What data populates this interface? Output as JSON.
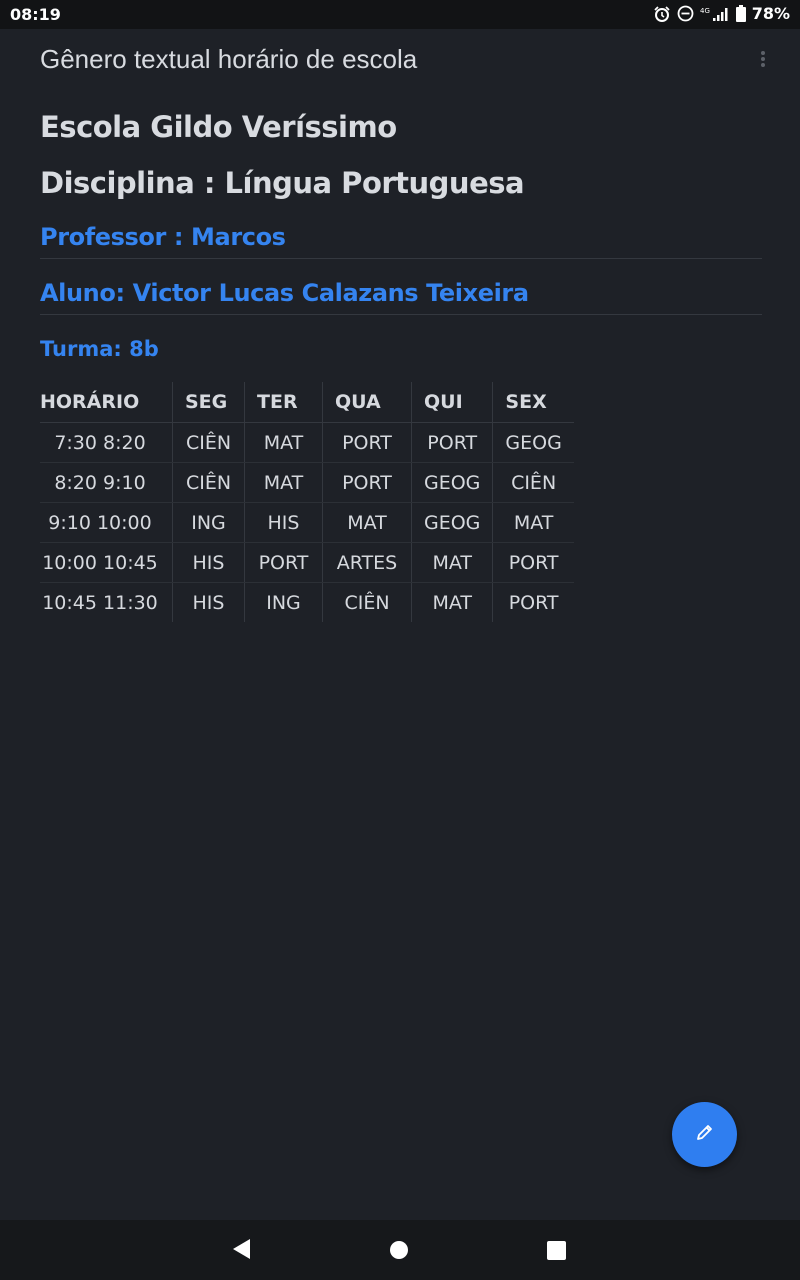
{
  "status_bar": {
    "time": "08:19",
    "network": "4G",
    "battery": "78%"
  },
  "toolbar": {
    "title": "Gênero textual horário de escola"
  },
  "document": {
    "school": "Escola Gildo Veríssimo",
    "discipline": "Disciplina : Língua Portuguesa",
    "teacher": "Professor : Marcos",
    "student": "Aluno: Victor Lucas Calazans Teixeira",
    "class": "Turma: 8b"
  },
  "schedule": {
    "headers": [
      "HORÁRIO",
      "SEG",
      "TER",
      "QUA",
      "QUI",
      "SEX"
    ],
    "rows": [
      [
        "7:30 8:20",
        "CIÊN",
        "MAT",
        "PORT",
        "PORT",
        "GEOG"
      ],
      [
        "8:20 9:10",
        "CIÊN",
        "MAT",
        "PORT",
        "GEOG",
        "CIÊN"
      ],
      [
        "9:10 10:00",
        "ING",
        "HIS",
        "MAT",
        "GEOG",
        "MAT"
      ],
      [
        "10:00 10:45",
        "HIS",
        "PORT",
        "ARTES",
        "MAT",
        "PORT"
      ],
      [
        "10:45 11:30",
        "HIS",
        "ING",
        "CIÊN",
        "MAT",
        "PORT"
      ]
    ]
  },
  "colors": {
    "background": "#1e2127",
    "accent": "#3584f0",
    "text": "#d8dbe0"
  }
}
